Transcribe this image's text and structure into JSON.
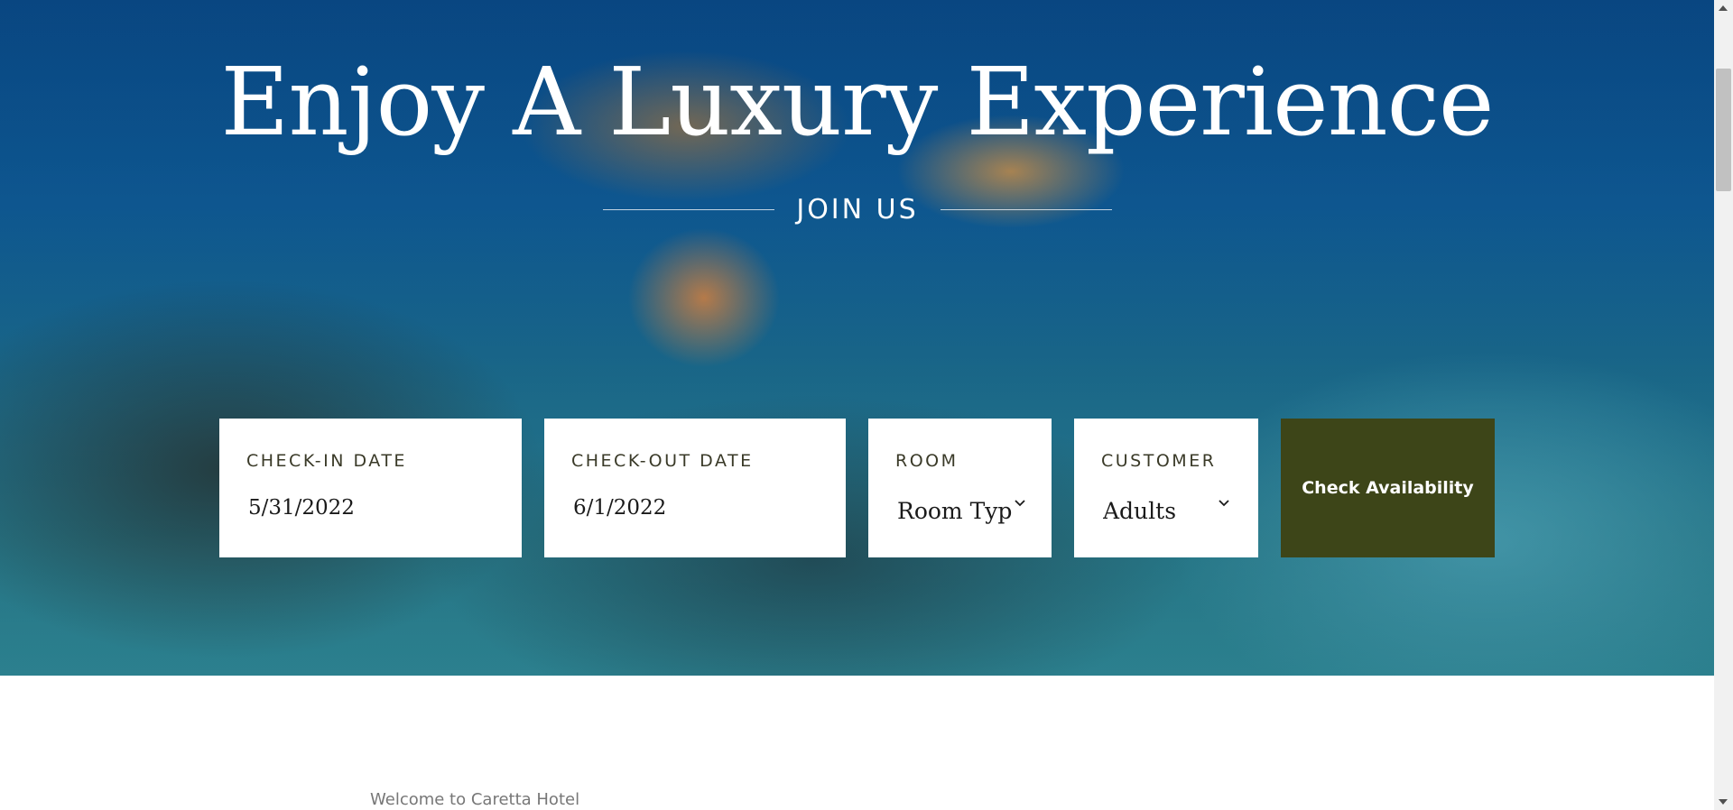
{
  "hero": {
    "title": "Enjoy A Luxury Experience",
    "subtitle": "JOIN US",
    "background": "sea-turtle-reef-photo"
  },
  "booking": {
    "checkin": {
      "label": "CHECK-IN DATE",
      "value": "5/31/2022"
    },
    "checkout": {
      "label": "CHECK-OUT DATE",
      "value": "6/1/2022"
    },
    "room": {
      "label": "ROOM",
      "value": "Room Type"
    },
    "customer": {
      "label": "CUSTOMER",
      "value": "Adults"
    },
    "button_label": "Check Availability"
  },
  "intro": {
    "welcome": "Welcome to Caretta Hotel"
  },
  "colors": {
    "button_bg": "#3d4518",
    "hero_text": "#ffffff",
    "label_text": "#3a3a28"
  }
}
